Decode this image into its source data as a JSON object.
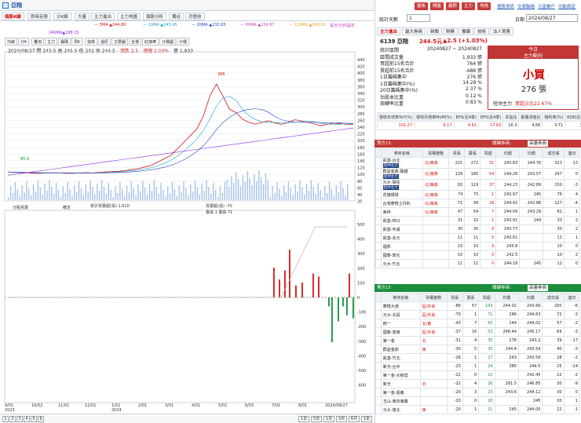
{
  "app": {
    "title": "亞翔"
  },
  "tabs": [
    "個股K線",
    "即時走勢",
    "分K線",
    "大量",
    "主力進出",
    "主力地圖",
    "個股分析",
    "備註",
    "月營收"
  ],
  "ma": [
    {
      "label": "5MA",
      "value": "244.80",
      "color": "#d31515"
    },
    {
      "label": "10MA",
      "value": "243.45",
      "color": "#17a1c8"
    },
    {
      "label": "20MA",
      "value": "232.65",
      "color": "#1f46c4"
    },
    {
      "label": "60MA",
      "value": "234.67",
      "color": "#c23fb0"
    },
    {
      "label": "120MA",
      "value": "249.92",
      "color": "#e6a21c"
    }
  ],
  "ma_extra": [
    "240MA▲188.15",
    "長日/分析設定"
  ],
  "tools": [
    "均線",
    "分K",
    "疊加",
    "主力",
    "籌碼",
    "周K",
    "指標",
    "還原",
    "主要圖",
    "全選",
    "紅綠棒",
    "分價圖",
    "分價"
  ],
  "info": {
    "line": "2024/08/27 開 243.5 高 245.5 低 242 收 244.5",
    "change": "漲跌 2.5",
    "pct": "漲幅 1.03%",
    "vol": "量 1,933"
  },
  "upper_price_labels": [
    "440",
    "420",
    "400",
    "380",
    "360",
    "340",
    "320",
    "300",
    "280",
    "260",
    "240",
    "220",
    "200",
    "180",
    "160",
    "140",
    "120",
    "100",
    "80",
    "60",
    "40",
    "20"
  ],
  "lower_labels": [
    "500",
    "400",
    "300",
    "200",
    "100",
    "0",
    "-100",
    "-200",
    "-300",
    "-400",
    "-500",
    "-600"
  ],
  "peak_label": "366",
  "low_label": "85.6",
  "lower_panel": {
    "select": "分點買賣",
    "button": "確定",
    "legend1": "累計買賣超(張) 1,610",
    "legend2": "買賣超(張) -70",
    "legend3": "賣張 1 賣張 71"
  },
  "x_labels": [
    "9/01\n2023",
    "10/02",
    "11/01",
    "12/01",
    "1/02\n2024",
    "2/01",
    "3/01",
    "4/01",
    "5/02",
    "6/03",
    "7/01",
    "8/01",
    "2024/08/27"
  ],
  "statusbar": {
    "pages": [
      "1",
      "2",
      "3",
      "4",
      "5",
      "6"
    ],
    "buttons": [
      "1日",
      "5日",
      "1月",
      "3月",
      "6月",
      "1年"
    ]
  },
  "right": {
    "buttons": [
      "盤後",
      "開盤",
      "趨勢",
      "主力",
      "地格"
    ],
    "links": [
      "選股資訊",
      "交易聯絡",
      "元富帳戶",
      "功能設定"
    ],
    "stat_days_label": "統計天數",
    "stat_days_value": "1",
    "date_label": "日期",
    "date_value": "2024/08/27",
    "subtabs": [
      "主力進出",
      "最大券商",
      "新聞",
      "財務",
      "籌碼",
      "技術",
      "法人買賣"
    ],
    "stock": "6139 亞翔",
    "price": "244.5元",
    "chg": "▲2.5 (+1.03%)",
    "stats": [
      [
        "統計區間",
        "20240827 ~ 20240827"
      ],
      [
        "區間成交量",
        "1,933 張"
      ],
      [
        "買超前15名合計",
        "764 張"
      ],
      [
        "賣超前15名合計",
        "-488 張"
      ],
      [
        "1日籌碼集中",
        "276 張"
      ],
      [
        "1日籌碼集中(%)",
        "14.28 %"
      ],
      [
        "20日籌碼集中(%)",
        "2.37 %"
      ],
      [
        "佔股本比重",
        "0.12 %"
      ],
      [
        "周轉率比重",
        "0.83 %"
      ]
    ],
    "today": {
      "head": "今日",
      "sub": "主力動向",
      "big": "小買",
      "count": "276 張",
      "note1": "短沖主力",
      "note2": "買超占比22.67%"
    },
    "metrics_head": [
      "營收年增率YoY(%)",
      "營收月增率MoM(%)",
      "EPS(近4季)",
      "EPS(近4季)",
      "本益比",
      "股價淨值比",
      "殖利率(%)",
      "ROE(近4季)"
    ],
    "metrics": [
      "101.27",
      "6.17",
      "4.61",
      "17.63",
      "16.3",
      "4.66",
      "3.71",
      "33.6"
    ],
    "buy_header": "買方15",
    "buy_filter": "關鍵券商:",
    "buy_filter_val": "高量券商",
    "sell_header": "賣方15",
    "sell_filter": "關鍵券商:",
    "sell_filter_val": "高量券商",
    "cols": [
      "",
      "券商名稱",
      "買權變數",
      "買張",
      "賣張",
      "買超",
      "均價",
      "均價",
      "成交張",
      "連日"
    ],
    "buy_rows": [
      [
        "凱基-台北",
        "短沖主力",
        "北/東森",
        "221",
        "272",
        "31",
        "243.83",
        "244.76",
        "323",
        "13"
      ],
      [
        "群益金鼎-臻雄",
        "短沖主力",
        "北/東森",
        "139",
        "180",
        "54",
        "244.26",
        "243.57",
        "247",
        "0"
      ],
      [
        "元大-陽信",
        "短沖主力",
        "北/東森",
        "82",
        "119",
        "37",
        "244.23",
        "242.89",
        "150",
        "-3"
      ],
      [
        "花旗環球",
        "",
        "北/東森",
        "74",
        "75",
        "1",
        "243.97",
        "245",
        "76",
        "4"
      ],
      [
        "台灣摩根士丹利",
        "",
        "北/東森",
        "71",
        "99",
        "28",
        "244.41",
        "242.86",
        "127",
        "-4"
      ],
      [
        "美林",
        "",
        "北/東森",
        "47",
        "54",
        "7",
        "244.09",
        "243.29",
        "81",
        "1"
      ],
      [
        "凱基-林口",
        "",
        "",
        "31",
        "32",
        "1",
        "243.91",
        "244",
        "33",
        "2"
      ],
      [
        "凱基-內湖",
        "",
        "",
        "30",
        "30",
        "0",
        "243.77",
        "",
        "30",
        "2"
      ],
      [
        "凱基-永元",
        "",
        "",
        "11",
        "11",
        "0",
        "243.61",
        "",
        "11",
        "1"
      ],
      [
        "福邦",
        "",
        "",
        "10",
        "10",
        "0",
        "243.8",
        "",
        "10",
        "0"
      ],
      [
        "國泰-敦化",
        "",
        "",
        "10",
        "10",
        "0",
        "242.5",
        "",
        "10",
        "2"
      ],
      [
        "元大-竹北",
        "",
        "",
        "11",
        "11",
        "0",
        "244.18",
        "245",
        "12",
        "0"
      ]
    ],
    "sell_rows": [
      [
        "摩根大通",
        "",
        "區/外資",
        "-86",
        "57",
        "143",
        "244.02",
        "243.66",
        "200",
        "-6"
      ],
      [
        "元大-北投",
        "",
        "區/外資",
        "-70",
        "1",
        "71",
        "286",
        "244.63",
        "72",
        "-3"
      ],
      [
        "統一",
        "",
        "北/東",
        "-43",
        "7",
        "50",
        "244",
        "244.02",
        "57",
        "-2"
      ],
      [
        "國泰-敦南",
        "",
        "區/外資",
        "-37",
        "16",
        "53",
        "248.44",
        "245.17",
        "69",
        "-3"
      ],
      [
        "第一金",
        "",
        "北",
        "-31",
        "4",
        "35",
        "276",
        "243.2",
        "39",
        "-17"
      ],
      [
        "群益金鼎",
        "",
        "東",
        "-30",
        "5",
        "35",
        "244.4",
        "243.54",
        "40",
        "-3"
      ],
      [
        "凱基-竹北",
        "",
        "",
        "-26",
        "1",
        "27",
        "243",
        "243.59",
        "28",
        "-2"
      ],
      [
        "新光-台中",
        "",
        "",
        "-23",
        "1",
        "24",
        "385",
        "244.5",
        "25",
        "-14"
      ],
      [
        "第一金-大稻埕",
        "",
        "",
        "-22",
        "0",
        "22",
        "",
        "242.45",
        "22",
        "-2"
      ],
      [
        "新光",
        "",
        "北",
        "-22",
        "4",
        "26",
        "281.5",
        "246.85",
        "30",
        "-9"
      ],
      [
        "第一金-嘉義",
        "",
        "",
        "-20",
        "3",
        "23",
        "243.6",
        "244.12",
        "30",
        "0"
      ],
      [
        "玉山-南京東路",
        "",
        "",
        "-20",
        "0",
        "20",
        "",
        "245",
        "20",
        "1"
      ],
      [
        "元大-復北",
        "",
        "東",
        "-20",
        "1",
        "21",
        "245",
        "244.05",
        "22",
        "-1"
      ]
    ]
  }
}
